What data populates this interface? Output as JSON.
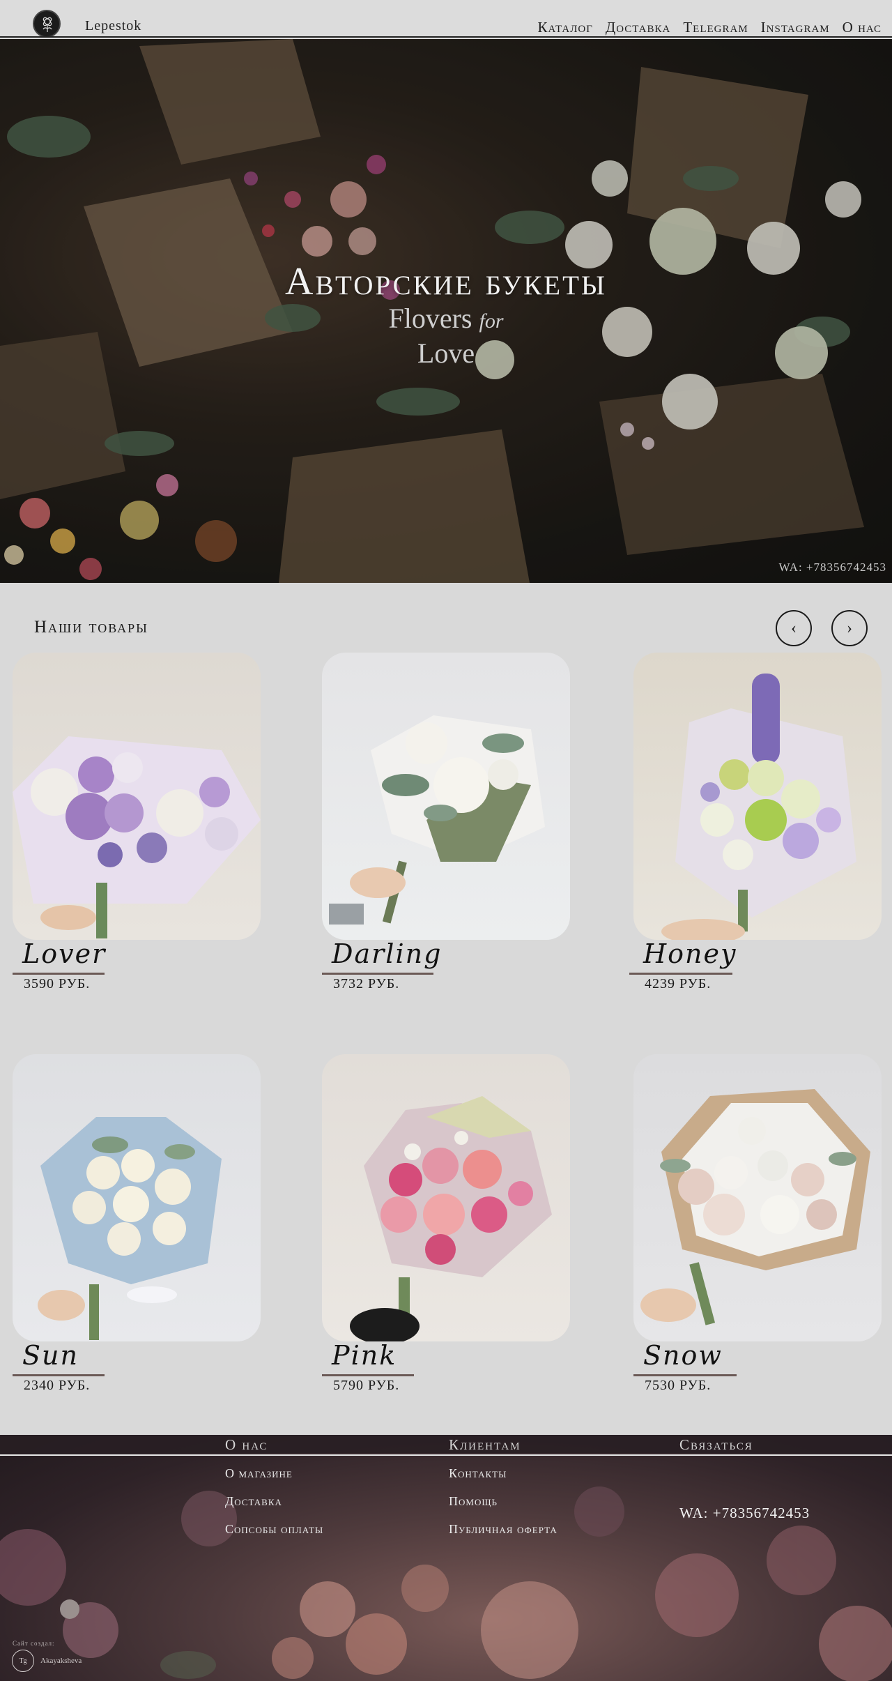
{
  "header": {
    "brand": "Lepestok",
    "nav": [
      "Каталог",
      "Доставка",
      "Telegram",
      "Instagram",
      "О нас"
    ]
  },
  "hero": {
    "title": "Авторские букеты",
    "subtitle_word1": "Flovers",
    "subtitle_for": "for",
    "subtitle_word2": "Love",
    "wa": "WA: +78356742453"
  },
  "products": {
    "title": "Наши товары",
    "prev_icon": "chevron-left-icon",
    "next_icon": "chevron-right-icon",
    "items": [
      {
        "name": "Lover",
        "price": "3590 РУБ."
      },
      {
        "name": "Darling",
        "price": "3732 РУБ."
      },
      {
        "name": "Honey",
        "price": "4239 РУБ."
      },
      {
        "name": "Sun",
        "price": "2340 РУБ."
      },
      {
        "name": "Pink",
        "price": "5790 РУБ."
      },
      {
        "name": "Snow",
        "price": "7530 РУБ."
      }
    ]
  },
  "footer": {
    "col1": {
      "title": "О нас",
      "links": [
        "О магазине",
        "Доставка",
        "Сопсобы оплаты"
      ]
    },
    "col2": {
      "title": "Клиентам",
      "links": [
        "Контакты",
        "Помощь",
        "Публичная оферта"
      ]
    },
    "col3": {
      "title": "Связаться",
      "wa": "WA: +78356742453"
    },
    "credit_label": "Сайт создал:",
    "credit_badge": "Tg",
    "credit_name": "Akayaksheva"
  },
  "colors": {
    "page_bg": "#d9d9d9",
    "text": "#1a1a1a",
    "underline": "#6b5a56"
  }
}
